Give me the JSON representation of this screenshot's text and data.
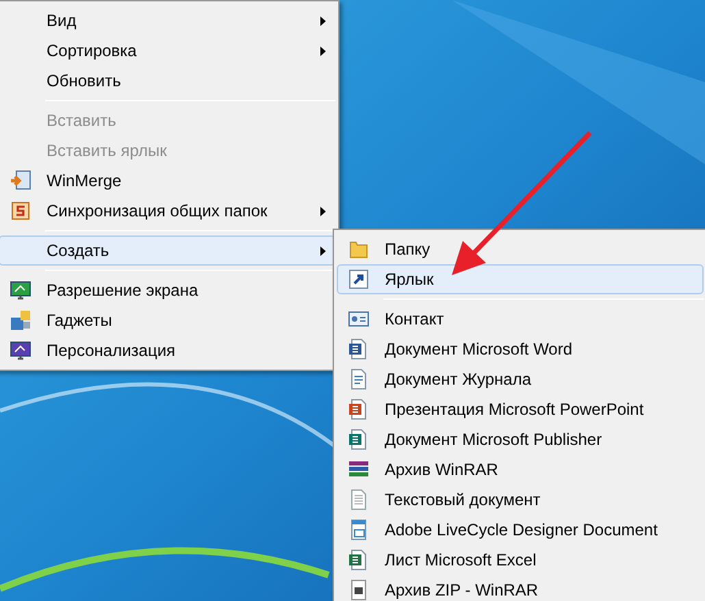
{
  "context_menu": {
    "items": [
      {
        "kind": "item",
        "label": "Вид",
        "submenu": true,
        "disabled": false,
        "selected": false
      },
      {
        "kind": "item",
        "label": "Сортировка",
        "submenu": true,
        "disabled": false,
        "selected": false
      },
      {
        "kind": "item",
        "label": "Обновить",
        "submenu": false,
        "disabled": false,
        "selected": false
      },
      {
        "kind": "separator"
      },
      {
        "kind": "item",
        "label": "Вставить",
        "submenu": false,
        "disabled": true,
        "selected": false
      },
      {
        "kind": "item",
        "label": "Вставить ярлык",
        "submenu": false,
        "disabled": true,
        "selected": false
      },
      {
        "kind": "item",
        "label": "WinMerge",
        "submenu": false,
        "disabled": false,
        "selected": false
      },
      {
        "kind": "item",
        "label": "Синхронизация общих папок",
        "submenu": true,
        "disabled": false,
        "selected": false
      },
      {
        "kind": "separator"
      },
      {
        "kind": "item",
        "label": "Создать",
        "submenu": true,
        "disabled": false,
        "selected": true
      },
      {
        "kind": "separator"
      },
      {
        "kind": "item",
        "label": "Разрешение экрана",
        "submenu": false,
        "disabled": false,
        "selected": false
      },
      {
        "kind": "item",
        "label": "Гаджеты",
        "submenu": false,
        "disabled": false,
        "selected": false
      },
      {
        "kind": "item",
        "label": "Персонализация",
        "submenu": false,
        "disabled": false,
        "selected": false
      }
    ]
  },
  "create_submenu": {
    "items": [
      {
        "kind": "item",
        "label": "Папку",
        "selected": false
      },
      {
        "kind": "item",
        "label": "Ярлык",
        "selected": true
      },
      {
        "kind": "separator"
      },
      {
        "kind": "item",
        "label": "Контакт",
        "selected": false
      },
      {
        "kind": "item",
        "label": "Документ Microsoft Word",
        "selected": false
      },
      {
        "kind": "item",
        "label": "Документ Журнала",
        "selected": false
      },
      {
        "kind": "item",
        "label": "Презентация Microsoft PowerPoint",
        "selected": false
      },
      {
        "kind": "item",
        "label": "Документ Microsoft Publisher",
        "selected": false
      },
      {
        "kind": "item",
        "label": "Архив WinRAR",
        "selected": false
      },
      {
        "kind": "item",
        "label": "Текстовый документ",
        "selected": false
      },
      {
        "kind": "item",
        "label": "Adobe LiveCycle Designer Document",
        "selected": false
      },
      {
        "kind": "item",
        "label": "Лист Microsoft Excel",
        "selected": false
      },
      {
        "kind": "item",
        "label": "Архив ZIP - WinRAR",
        "selected": false
      }
    ]
  }
}
